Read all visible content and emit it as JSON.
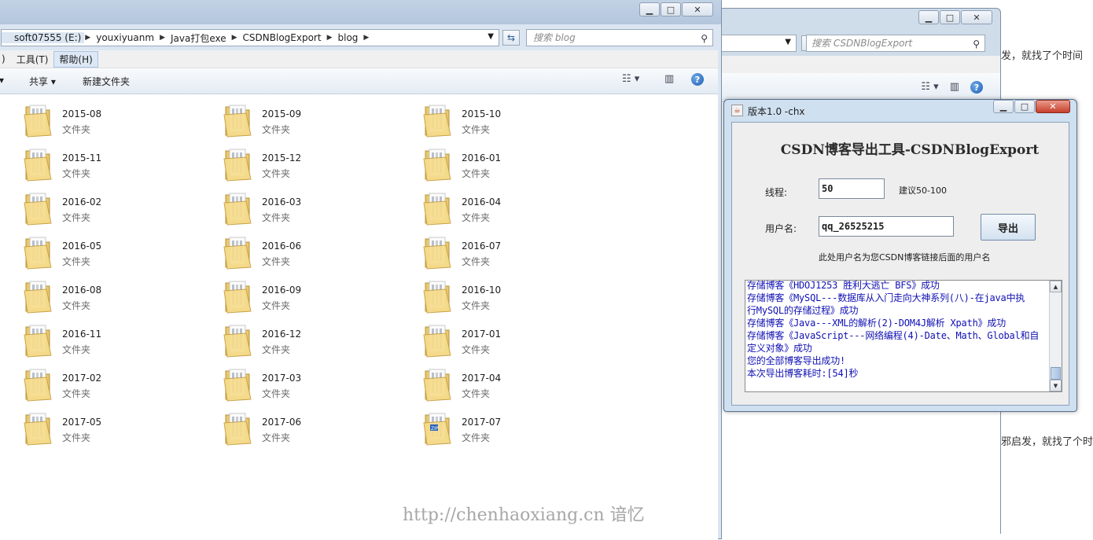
{
  "background_window": {
    "search_placeholder": "搜索 CSDNBlogExport",
    "article_line_1": "发，就找了个时间",
    "article_line_2": "邪启发，就找了个时"
  },
  "explorer": {
    "breadcrumbs": [
      "soft07555 (E:)",
      "youxiyuanm",
      "Java打包exe",
      "CSDNBlogExport",
      "blog"
    ],
    "search_placeholder": "搜索 blog",
    "menu": [
      ")",
      "工具(T)",
      "帮助(H)"
    ],
    "toolbar": {
      "share_label": "共享",
      "new_folder_label": "新建文件夹"
    },
    "folders": [
      {
        "name": "2015-08",
        "type": "文件夹"
      },
      {
        "name": "2015-09",
        "type": "文件夹"
      },
      {
        "name": "2015-10",
        "type": "文件夹"
      },
      {
        "name": "2015-11",
        "type": "文件夹"
      },
      {
        "name": "2015-12",
        "type": "文件夹"
      },
      {
        "name": "2016-01",
        "type": "文件夹"
      },
      {
        "name": "2016-02",
        "type": "文件夹"
      },
      {
        "name": "2016-03",
        "type": "文件夹"
      },
      {
        "name": "2016-04",
        "type": "文件夹"
      },
      {
        "name": "2016-05",
        "type": "文件夹"
      },
      {
        "name": "2016-06",
        "type": "文件夹"
      },
      {
        "name": "2016-07",
        "type": "文件夹"
      },
      {
        "name": "2016-08",
        "type": "文件夹"
      },
      {
        "name": "2016-09",
        "type": "文件夹"
      },
      {
        "name": "2016-10",
        "type": "文件夹"
      },
      {
        "name": "2016-11",
        "type": "文件夹"
      },
      {
        "name": "2016-12",
        "type": "文件夹"
      },
      {
        "name": "2017-01",
        "type": "文件夹"
      },
      {
        "name": "2017-02",
        "type": "文件夹"
      },
      {
        "name": "2017-03",
        "type": "文件夹"
      },
      {
        "name": "2017-04",
        "type": "文件夹"
      },
      {
        "name": "2017-05",
        "type": "文件夹"
      },
      {
        "name": "2017-06",
        "type": "文件夹"
      },
      {
        "name": "2017-07",
        "type": "文件夹"
      }
    ]
  },
  "watermark": "http://chenhaoxiang.cn 谙忆",
  "app": {
    "title": "版本1.0 -chx",
    "heading": "CSDN博客导出工具-CSDNBlogExport",
    "threads_label": "线程:",
    "threads_value": "50",
    "threads_hint": "建议50-100",
    "username_label": "用户名:",
    "username_value": "qq_26525215",
    "export_label": "导出",
    "username_hint": "此处用户名为您CSDN博客链接后面的用户名",
    "log": [
      "存储博客《HDOJ1253 胜利大逃亡 BFS》成功",
      "存储博客《MySQL---数据库从入门走向大神系列(八)-在java中执",
      "行MySQL的存储过程》成功",
      "存储博客《Java---XML的解析(2)-DOM4J解析 Xpath》成功",
      "存储博客《JavaScript---网络编程(4)-Date、Math、Global和自",
      "定义对象》成功",
      "您的全部博客导出成功!",
      "本次导出博客耗时:[54]秒"
    ]
  }
}
